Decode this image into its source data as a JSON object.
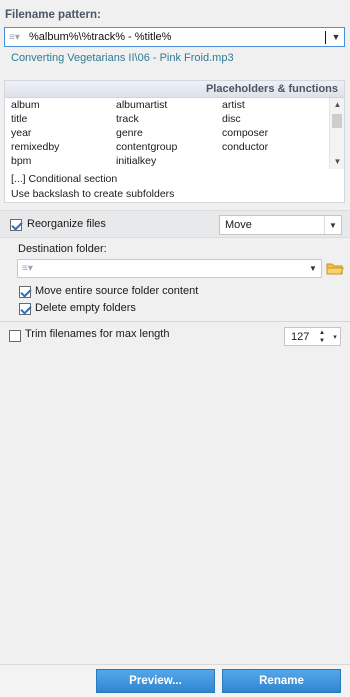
{
  "filename_pattern": {
    "label": "Filename pattern:",
    "value": "%album%\\%track% - %title%"
  },
  "preview_path": "Converting Vegetarians II\\06 - Pink Froid.mp3",
  "placeholders": {
    "header": "Placeholders & functions",
    "items": [
      "album",
      "albumartist",
      "artist",
      "title",
      "track",
      "disc",
      "year",
      "genre",
      "composer",
      "remixedby",
      "contentgroup",
      "conductor",
      "bpm",
      "initialkey"
    ],
    "note_conditional": "[...] Conditional section",
    "note_backslash": "Use backslash to create subfolders"
  },
  "reorganize": {
    "label": "Reorganize files",
    "checked": true,
    "mode": "Move"
  },
  "destination": {
    "label": "Destination folder:",
    "value": ""
  },
  "options": {
    "move_entire": "Move entire source folder content",
    "delete_empty": "Delete empty folders"
  },
  "trim": {
    "label": "Trim filenames for max length",
    "checked": false,
    "value": "127"
  },
  "buttons": {
    "preview": "Preview...",
    "rename": "Rename"
  },
  "colors": {
    "accent": "#2f86d2",
    "link": "#2c7d96",
    "header_text": "#4a5566"
  }
}
